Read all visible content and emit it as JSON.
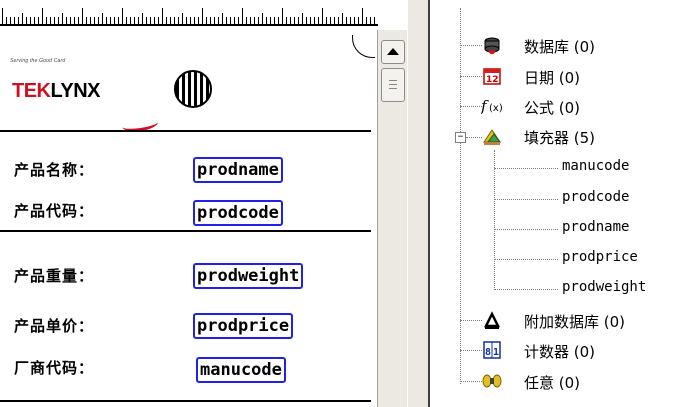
{
  "label": {
    "logo": {
      "tagline": "Serving the Good Card",
      "brand_prefix": "TEK",
      "brand_suffix": "LYNX"
    },
    "fields": [
      {
        "label": "产品名称：",
        "value": "prodname"
      },
      {
        "label": "产品代码：",
        "value": "prodcode"
      },
      {
        "label": "产品重量：",
        "value": "prodweight"
      },
      {
        "label": "产品单价：",
        "value": "prodprice"
      },
      {
        "label": "厂商代码：",
        "value": "manucode"
      }
    ]
  },
  "tree": {
    "nodes": [
      {
        "label": "数据库 (0)",
        "icon": "database-icon"
      },
      {
        "label": "日期 (0)",
        "icon": "calendar-icon"
      },
      {
        "label": "公式 (0)",
        "icon": "formula-icon"
      },
      {
        "label": "填充器 (5)",
        "icon": "filler-icon",
        "expanded": true,
        "children": [
          "manucode",
          "prodcode",
          "prodname",
          "prodprice",
          "prodweight"
        ]
      },
      {
        "label": "附加数据库 (0)",
        "icon": "additional-database-icon"
      },
      {
        "label": "计数器 (0)",
        "icon": "counter-icon"
      },
      {
        "label": "任意 (0)",
        "icon": "free-icon"
      }
    ],
    "expander_symbol": "−"
  },
  "colors": {
    "field_border": "#2020e8",
    "brand_red": "#d01020"
  }
}
